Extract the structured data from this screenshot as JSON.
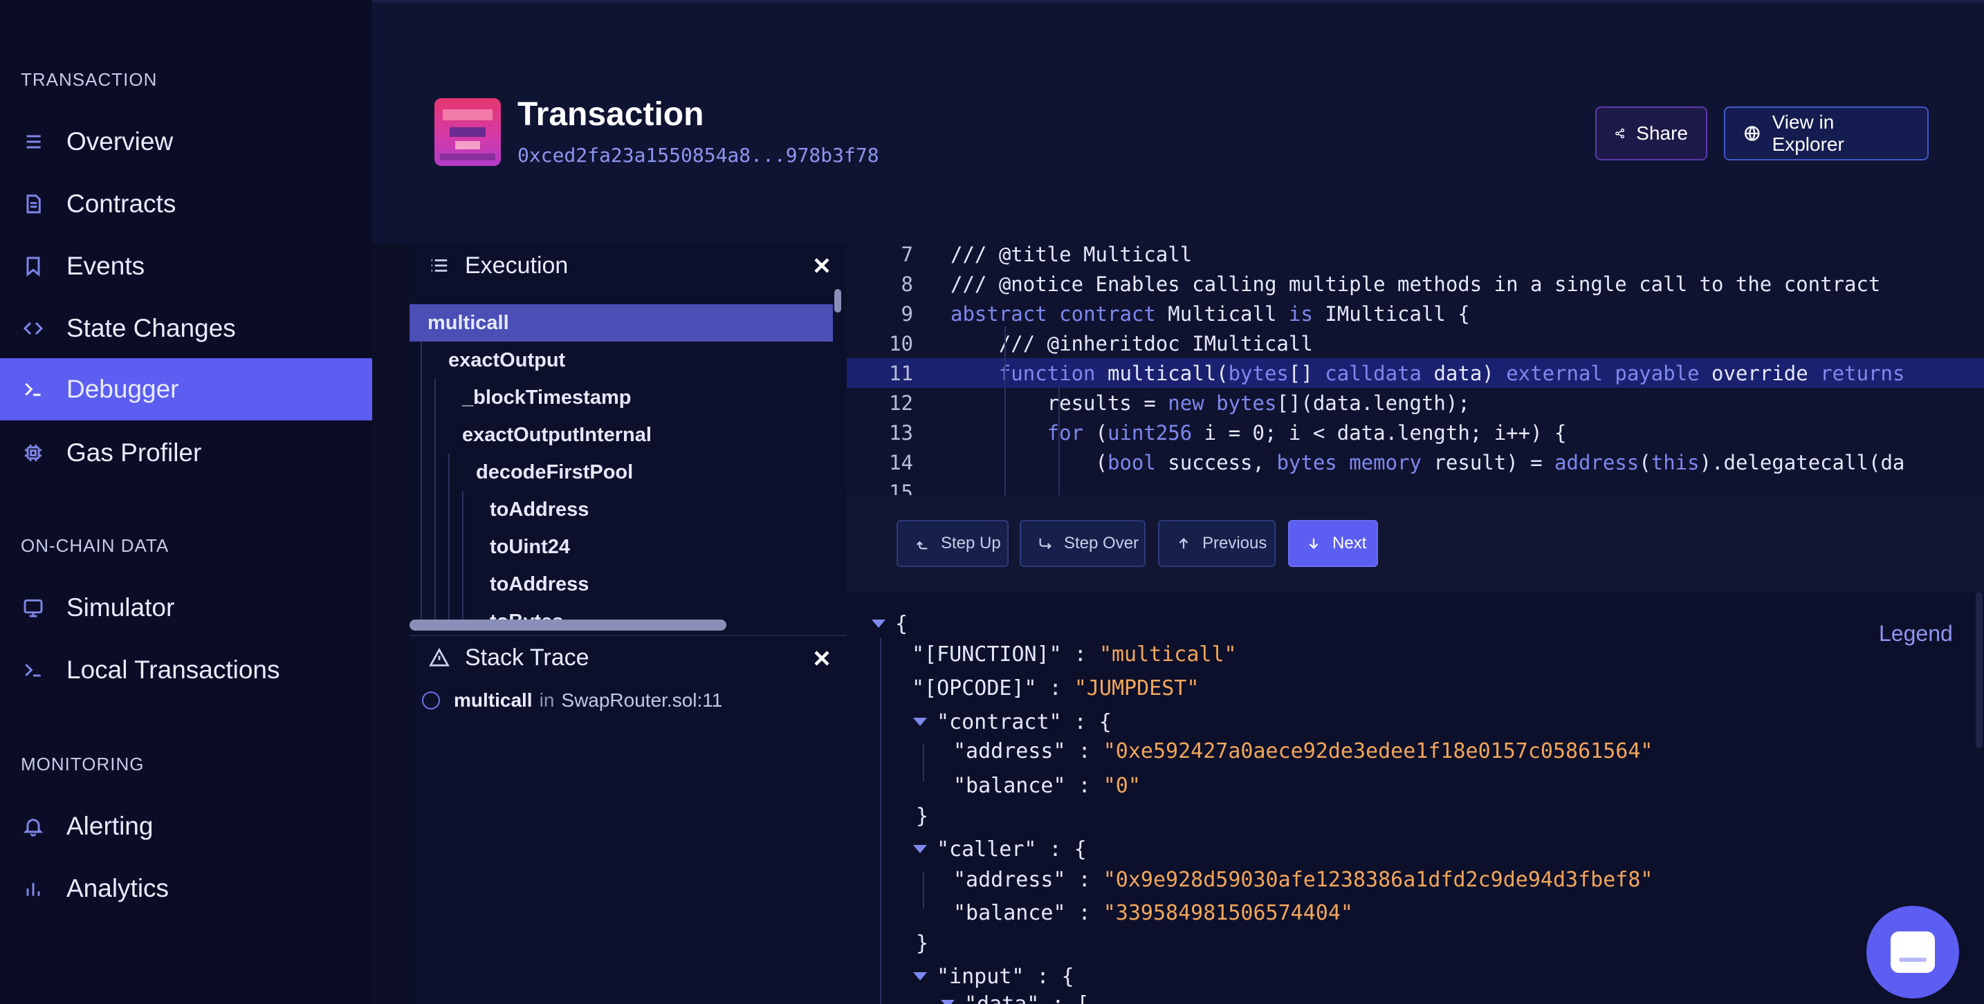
{
  "sidebar": {
    "sections": [
      {
        "label": "TRANSACTION"
      },
      {
        "label": "ON-CHAIN DATA"
      },
      {
        "label": "MONITORING"
      }
    ],
    "items": [
      {
        "label": "Overview",
        "icon": "list-icon"
      },
      {
        "label": "Contracts",
        "icon": "document-icon"
      },
      {
        "label": "Events",
        "icon": "bookmark-icon"
      },
      {
        "label": "State Changes",
        "icon": "code-icon"
      },
      {
        "label": "Debugger",
        "icon": "terminal-icon",
        "active": true
      },
      {
        "label": "Gas Profiler",
        "icon": "cpu-icon"
      },
      {
        "label": "Simulator",
        "icon": "monitor-icon"
      },
      {
        "label": "Local Transactions",
        "icon": "terminal-icon"
      },
      {
        "label": "Alerting",
        "icon": "bell-icon"
      },
      {
        "label": "Analytics",
        "icon": "bar-chart-icon"
      }
    ]
  },
  "header": {
    "title": "Transaction",
    "hash": "0xced2fa23a1550854a8...978b3f78",
    "share_label": "Share",
    "explorer_label": "View in Explorer"
  },
  "execution": {
    "title": "Execution",
    "rows": [
      {
        "label": "multicall",
        "depth": 0,
        "active": true
      },
      {
        "label": "exactOutput",
        "depth": 1
      },
      {
        "label": "_blockTimestamp",
        "depth": 2
      },
      {
        "label": "exactOutputInternal",
        "depth": 2
      },
      {
        "label": "decodeFirstPool",
        "depth": 3
      },
      {
        "label": "toAddress",
        "depth": 4
      },
      {
        "label": "toUint24",
        "depth": 4
      },
      {
        "label": "toAddress",
        "depth": 4
      },
      {
        "label": "toBytes",
        "depth": 4
      }
    ]
  },
  "stack_trace": {
    "title": "Stack Trace",
    "frame_fn": "multicall",
    "frame_in": "in",
    "frame_loc": "SwapRouter.sol:11"
  },
  "code": {
    "highlight_line": 11,
    "lines": [
      {
        "n": "7",
        "text": "/// @title Multicall"
      },
      {
        "n": "8",
        "text": "/// @notice Enables calling multiple methods in a single call to the contract"
      },
      {
        "n": "9",
        "text": "abstract contract Multicall is IMulticall {"
      },
      {
        "n": "10",
        "text": "    /// @inheritdoc IMulticall"
      },
      {
        "n": "11",
        "text": "    function multicall(bytes[] calldata data) external payable override returns"
      },
      {
        "n": "12",
        "text": "        results = new bytes[](data.length);"
      },
      {
        "n": "13",
        "text": "        for (uint256 i = 0; i < data.length; i++) {"
      },
      {
        "n": "14",
        "text": "            (bool success, bytes memory result) = address(this).delegatecall(da"
      },
      {
        "n": "15",
        "text": ""
      }
    ]
  },
  "controls": {
    "step_up": "Step Up",
    "step_over": "Step Over",
    "previous": "Previous",
    "next": "Next"
  },
  "json_view": {
    "legend": "Legend",
    "function_key": "\"[FUNCTION]\"",
    "function_val": "\"multicall\"",
    "opcode_key": "\"[OPCODE]\"",
    "opcode_val": "\"JUMPDEST\"",
    "contract_key": "\"contract\"",
    "contract_address": "\"0xe592427a0aece92de3edee1f18e0157c05861564\"",
    "contract_balance": "\"0\"",
    "caller_key": "\"caller\"",
    "caller_address": "\"0x9e928d59030afe1238386a1dfd2c9de94d3fbef8\"",
    "caller_balance": "\"339584981506574404\"",
    "address_key": "\"address\"",
    "balance_key": "\"balance\"",
    "input_key": "\"input\"",
    "data_key": "\"data\""
  },
  "colors": {
    "accent": "#5b5ef0",
    "sidebar_bg": "#0b0d26",
    "string": "#f2a65a",
    "comment": "#77c66f",
    "keyword": "#7f88ee"
  }
}
